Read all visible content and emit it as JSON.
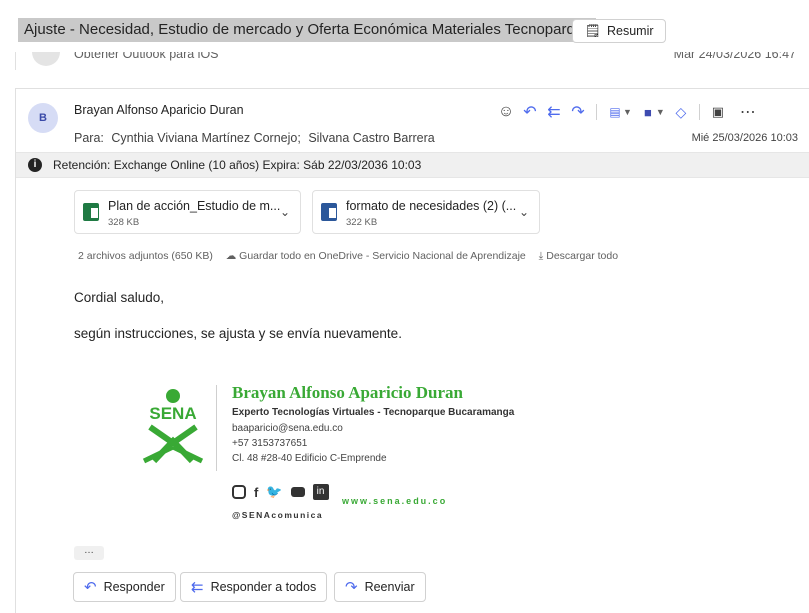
{
  "subject": {
    "text": "Ajuste - Necesidad, Estudio de mercado y Oferta Económica Materiales Tecnoparque",
    "summarize_label": "Resumir"
  },
  "previous_message": {
    "preview": "Obtener Outlook para iOS",
    "date": "Mar 24/03/2026 16:47"
  },
  "message": {
    "avatar_initial": "B",
    "sender": "Brayan Alfonso Aparicio Duran",
    "to_label": "Para:",
    "recipients": [
      "Cynthia Viviana Martínez Cornejo;",
      "Silvana Castro Barrera"
    ],
    "date": "Mié 25/03/2026 10:03",
    "retention": "Retención: Exchange Online (10 años) Expira: Sáb 22/03/2036 10:03",
    "attachments": [
      {
        "name": "Plan de acción_Estudio de m...",
        "size": "328 KB"
      },
      {
        "name": "formato de necesidades (2) (...",
        "size": "322 KB"
      }
    ],
    "attachments_summary": "2 archivos adjuntos (650 KB)",
    "save_onedrive": "Guardar todo en OneDrive - Servicio Nacional de Aprendizaje",
    "download_all": "Descargar todo",
    "greeting": "Cordial saludo,",
    "body": "según instrucciones, se ajusta y se envía nuevamente."
  },
  "signature": {
    "logo_text": "SENA",
    "name": "Brayan Alfonso Aparicio Duran",
    "role": "Experto Tecnologías Virtuales - Tecnoparque Bucaramanga",
    "email": "baaparicio@sena.edu.co",
    "phone": "+57 3153737651",
    "address": "Cl. 48 #28-40 Edificio C-Emprende",
    "web": "www.sena.edu.co",
    "handle": "@SENAcomunica"
  },
  "reply_bar": {
    "reply": "Responder",
    "reply_all": "Responder a todos",
    "forward": "Reenviar"
  },
  "colors": {
    "accent": "#4f6bed",
    "sena_green": "#39a935"
  }
}
